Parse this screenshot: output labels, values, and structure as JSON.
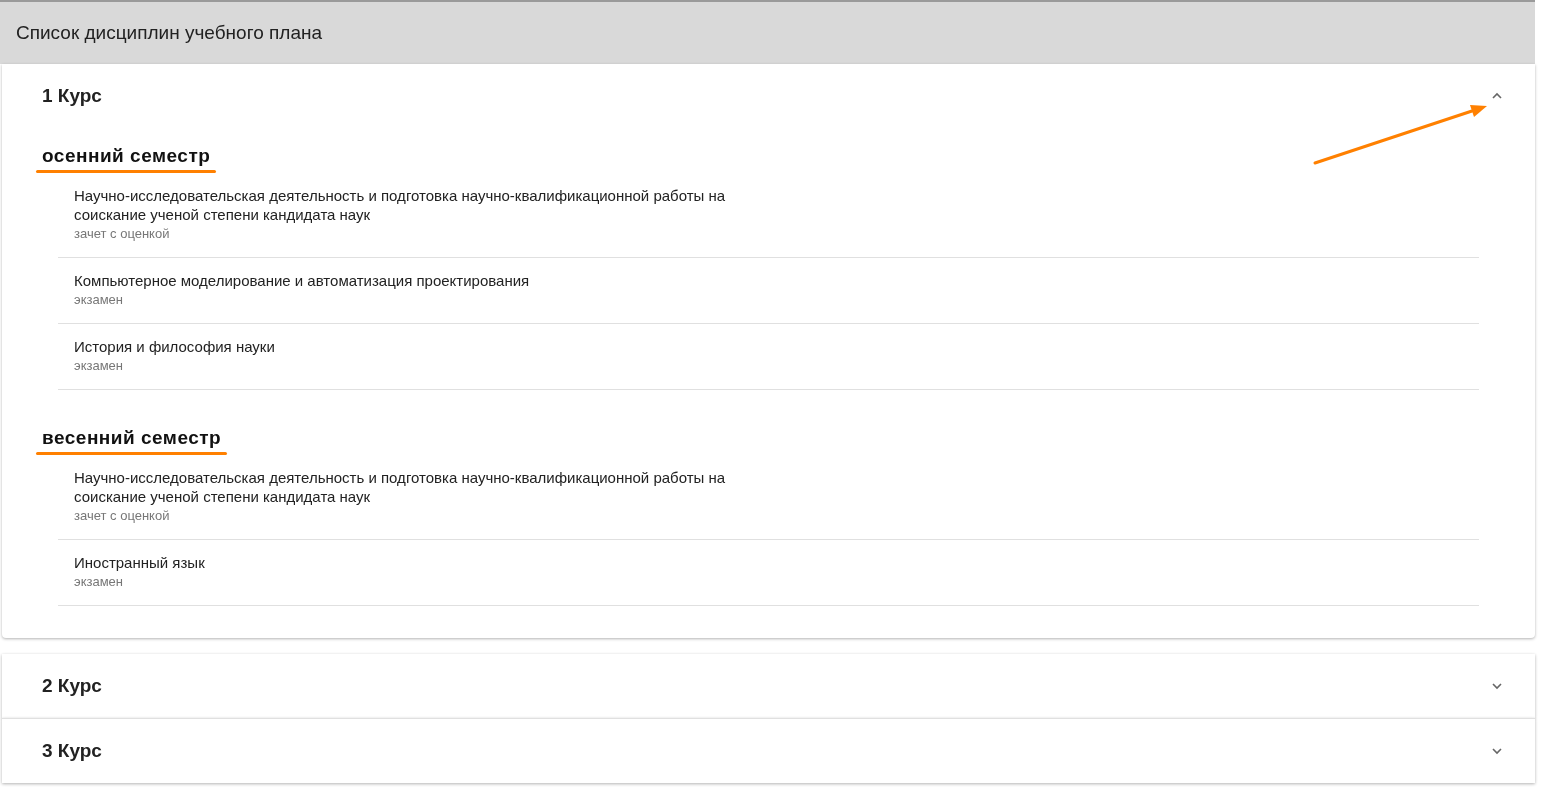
{
  "page_title": "Список дисциплин учебного плана",
  "courses": [
    {
      "title": "1 Курс",
      "expanded": true,
      "annotated": true,
      "semesters": [
        {
          "title": "осенний семестр",
          "underlined": true,
          "disciplines": [
            {
              "name": "Научно-исследовательская деятельность и подготовка научно-квалификационной работы на соискание ученой степени кандидата наук",
              "assessment": "зачет с оценкой"
            },
            {
              "name": "Компьютерное моделирование и автоматизация проектирования",
              "assessment": "экзамен"
            },
            {
              "name": "История и философия науки",
              "assessment": "экзамен"
            }
          ]
        },
        {
          "title": "весенний семестр",
          "underlined": true,
          "disciplines": [
            {
              "name": "Научно-исследовательская деятельность и подготовка научно-квалификационной работы на соискание ученой степени кандидата наук",
              "assessment": "зачет с оценкой"
            },
            {
              "name": "Иностранный язык",
              "assessment": "экзамен"
            }
          ]
        }
      ]
    },
    {
      "title": "2 Курс",
      "expanded": false,
      "annotated": false
    },
    {
      "title": "3 Курс",
      "expanded": false,
      "annotated": false
    }
  ]
}
